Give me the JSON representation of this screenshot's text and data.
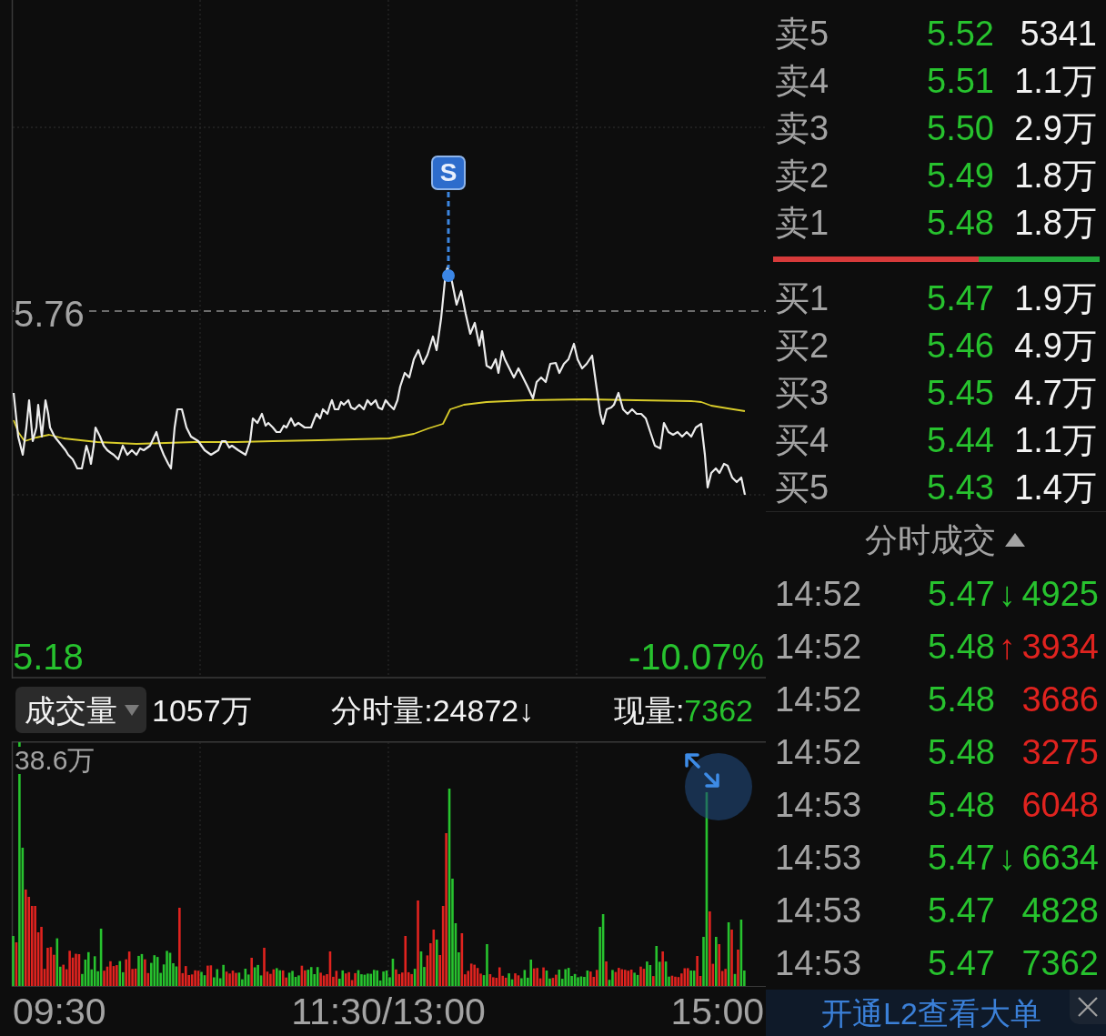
{
  "price_chart": {
    "signal_marker": {
      "label": "S"
    },
    "prev_close_label": "5.76",
    "low_price_label": "5.18",
    "low_percent_label": "-10.07%"
  },
  "volume_header": {
    "selector": {
      "label": "成交量"
    },
    "total": "1057万",
    "minute_volume": "分时量:24872↓",
    "current_label": "现量:",
    "current_value": "7362"
  },
  "volume_chart": {
    "max_label": "38.6万"
  },
  "time_axis": [
    "09:30",
    "11:30/13:00",
    "15:00"
  ],
  "order_book": {
    "asks": [
      {
        "label": "卖5",
        "price": "5.52",
        "volume": "5341"
      },
      {
        "label": "卖4",
        "price": "5.51",
        "volume": "1.1万"
      },
      {
        "label": "卖3",
        "price": "5.50",
        "volume": "2.9万"
      },
      {
        "label": "卖2",
        "price": "5.49",
        "volume": "1.8万"
      },
      {
        "label": "卖1",
        "price": "5.48",
        "volume": "1.8万"
      }
    ],
    "ratio_bar": {
      "level": 0.63
    },
    "bids": [
      {
        "label": "买1",
        "price": "5.47",
        "volume": "1.9万"
      },
      {
        "label": "买2",
        "price": "5.46",
        "volume": "4.9万"
      },
      {
        "label": "买3",
        "price": "5.45",
        "volume": "4.7万"
      },
      {
        "label": "买4",
        "price": "5.44",
        "volume": "1.1万"
      },
      {
        "label": "买5",
        "price": "5.43",
        "volume": "1.4万"
      }
    ]
  },
  "trades": {
    "title": "分时成交",
    "rows": [
      {
        "time": "14:52",
        "price": "5.47",
        "arrow": "↓",
        "volume": "4925",
        "color": "#27c22e"
      },
      {
        "time": "14:52",
        "price": "5.48",
        "arrow": "↑",
        "volume": "3934",
        "color": "#e0231f"
      },
      {
        "time": "14:52",
        "price": "5.48",
        "volume": "3686",
        "color": "#e0231f"
      },
      {
        "time": "14:52",
        "price": "5.48",
        "volume": "3275",
        "color": "#e0231f"
      },
      {
        "time": "14:53",
        "price": "5.48",
        "volume": "6048",
        "color": "#e0231f"
      },
      {
        "time": "14:53",
        "price": "5.47",
        "arrow": "↓",
        "volume": "6634",
        "color": "#27c22e"
      },
      {
        "time": "14:53",
        "price": "5.47",
        "volume": "4828",
        "color": "#27c22e"
      },
      {
        "time": "14:53",
        "price": "5.47",
        "volume": "7362",
        "color": "#27c22e"
      }
    ]
  },
  "banner": {
    "text": "开通L2查看大单"
  }
}
